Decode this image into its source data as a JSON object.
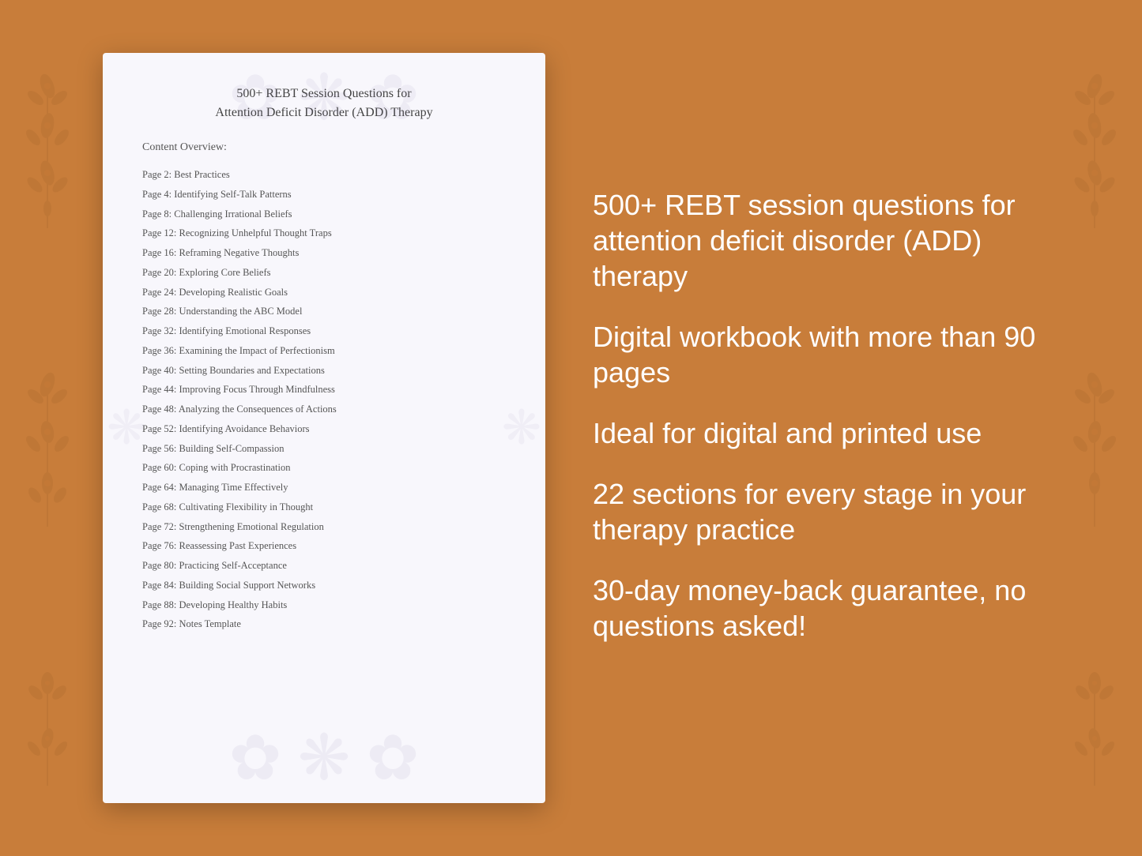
{
  "background": {
    "color": "#C87D3A"
  },
  "document": {
    "title_line1": "500+ REBT Session Questions for",
    "title_line2": "Attention Deficit Disorder (ADD) Therapy",
    "content_overview_label": "Content Overview:",
    "toc_items": [
      {
        "page": "2",
        "title": "Best Practices"
      },
      {
        "page": "4",
        "title": "Identifying Self-Talk Patterns"
      },
      {
        "page": "8",
        "title": "Challenging Irrational Beliefs"
      },
      {
        "page": "12",
        "title": "Recognizing Unhelpful Thought Traps"
      },
      {
        "page": "16",
        "title": "Reframing Negative Thoughts"
      },
      {
        "page": "20",
        "title": "Exploring Core Beliefs"
      },
      {
        "page": "24",
        "title": "Developing Realistic Goals"
      },
      {
        "page": "28",
        "title": "Understanding the ABC Model"
      },
      {
        "page": "32",
        "title": "Identifying Emotional Responses"
      },
      {
        "page": "36",
        "title": "Examining the Impact of Perfectionism"
      },
      {
        "page": "40",
        "title": "Setting Boundaries and Expectations"
      },
      {
        "page": "44",
        "title": "Improving Focus Through Mindfulness"
      },
      {
        "page": "48",
        "title": "Analyzing the Consequences of Actions"
      },
      {
        "page": "52",
        "title": "Identifying Avoidance Behaviors"
      },
      {
        "page": "56",
        "title": "Building Self-Compassion"
      },
      {
        "page": "60",
        "title": "Coping with Procrastination"
      },
      {
        "page": "64",
        "title": "Managing Time Effectively"
      },
      {
        "page": "68",
        "title": "Cultivating Flexibility in Thought"
      },
      {
        "page": "72",
        "title": "Strengthening Emotional Regulation"
      },
      {
        "page": "76",
        "title": "Reassessing Past Experiences"
      },
      {
        "page": "80",
        "title": "Practicing Self-Acceptance"
      },
      {
        "page": "84",
        "title": "Building Social Support Networks"
      },
      {
        "page": "88",
        "title": "Developing Healthy Habits"
      },
      {
        "page": "92",
        "title": "Notes Template"
      }
    ]
  },
  "info_panel": {
    "blocks": [
      {
        "id": "block1",
        "text": "500+ REBT session questions for attention deficit disorder (ADD) therapy"
      },
      {
        "id": "block2",
        "text": "Digital workbook with more than 90 pages"
      },
      {
        "id": "block3",
        "text": "Ideal for digital and printed use"
      },
      {
        "id": "block4",
        "text": "22 sections for every stage in your therapy practice"
      },
      {
        "id": "block5",
        "text": "30-day money-back guarantee, no questions asked!"
      }
    ]
  }
}
